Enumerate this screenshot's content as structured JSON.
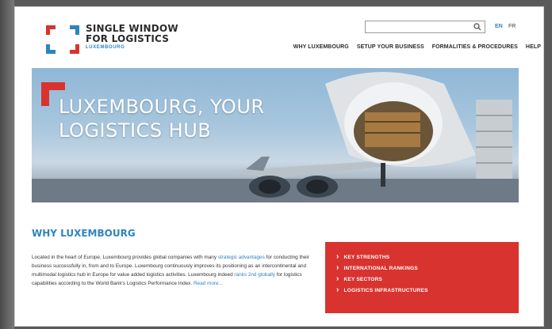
{
  "brand": {
    "line1": "SINGLE WINDOW",
    "line2": "FOR LOGISTICS",
    "subline": "LUXEMBOURG",
    "colors": {
      "red": "#d8332f",
      "blue": "#2f84c0"
    }
  },
  "search": {
    "placeholder": ""
  },
  "languages": [
    "EN",
    "FR"
  ],
  "nav": [
    "WHY LUXEMBOURG",
    "SETUP YOUR BUSINESS",
    "FORMALITIES & PROCEDURES",
    "HELP"
  ],
  "hero": {
    "title_line1": "LUXEMBOURG, YOUR",
    "title_line2": "LOGISTICS HUB"
  },
  "section": {
    "title": "WHY LUXEMBOURG",
    "text_start": "Located in the heart of Europe, Luxembourg provides global companies with many ",
    "link1": "strategic advantages",
    "text_mid": " for conducting their business successfully in, from and to Europe. Luxembourg continuously improves its positioning as an intercontinental and multimodal logistics hub in Europe for value added logistics activities. Luxembourg indeed ",
    "link2": "ranks 2nd globally",
    "text_end": " for logistics capabilities according to the World Bank's Logistics Performance Index. ",
    "read_more": "Read more..."
  },
  "quick_links": [
    "KEY STRENGTHS",
    "INTERNATIONAL RANKINGS",
    "KEY SECTORS",
    "LOGISTICS INFRASTRUCTURES"
  ]
}
